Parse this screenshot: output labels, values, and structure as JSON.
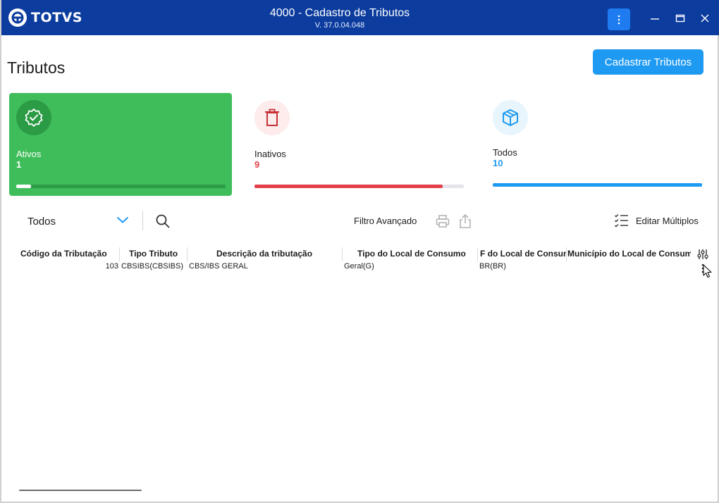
{
  "titlebar": {
    "logo_text": "TOTVS",
    "title": "4000 - Cadastro de Tributos",
    "version": "V. 37.0.04.048"
  },
  "page": {
    "title": "Tributos",
    "primary_button": "Cadastrar Tributos"
  },
  "cards": {
    "ativos": {
      "label": "Ativos",
      "value": "1",
      "progress": 0.07,
      "color": "#3fbd5a",
      "icon": "check-badge-icon"
    },
    "inativos": {
      "label": "Inativos",
      "value": "9",
      "progress": 0.9,
      "color": "#e2414b",
      "icon": "trash-icon"
    },
    "todos": {
      "label": "Todos",
      "value": "10",
      "progress": 1.0,
      "color": "#1f9af2",
      "icon": "box-icon"
    }
  },
  "toolbar": {
    "filter_value": "Todos",
    "advanced_filter": "Filtro Avançado",
    "edit_multiple": "Editar Múltiplos"
  },
  "table": {
    "headers": {
      "codigo": "Código da Tributação",
      "tipo": "Tipo Tributo",
      "descricao": "Descrição da tributação",
      "tipo_local": "Tipo do Local de Consumo",
      "uf_local": "F do Local de Consum",
      "municipio": "Município do Local de Consumo"
    },
    "rows": [
      {
        "codigo": "103",
        "tipo": "CBSIBS(CBSIBS)",
        "descricao": "CBS/IBS GERAL",
        "tipo_local": "Geral(G)",
        "uf_local": "BR(BR)",
        "municipio": ""
      }
    ]
  },
  "colors": {
    "titlebar": "#0c3c9e",
    "accent": "#1f9af2",
    "success": "#3fbd5a",
    "danger": "#e2414b"
  }
}
